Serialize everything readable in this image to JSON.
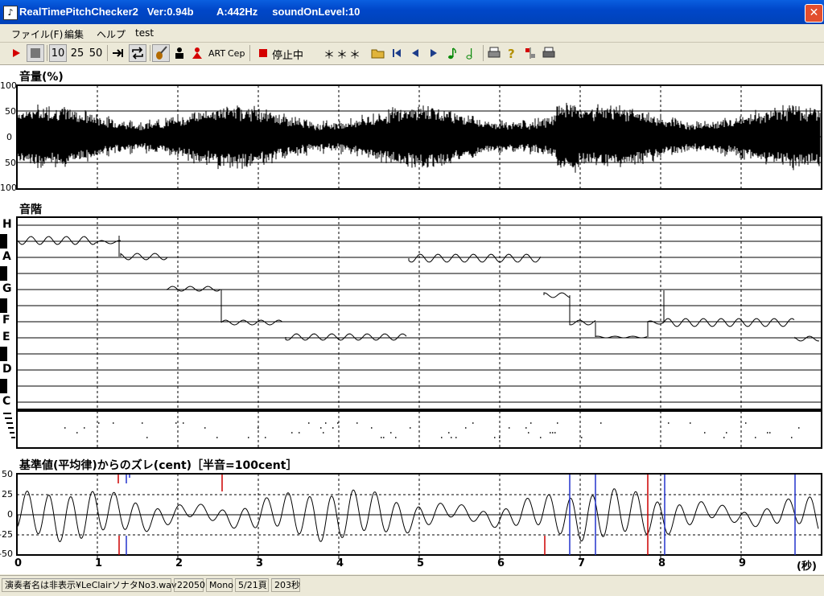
{
  "window": {
    "title": "RealTimePitchChecker2   Ver:0.94b        A:442Hz     soundOnLevel:10",
    "close_glyph": "✕"
  },
  "menu": [
    "ファイル(F)",
    "編集",
    "ヘルプ",
    "test"
  ],
  "toolbar": {
    "speed_10": "10",
    "speed_25": "25",
    "speed_50": "50",
    "art": "ART",
    "cep": "Cep",
    "status_text": "停止中",
    "stars": "＊＊＊"
  },
  "volume_panel": {
    "title": "音量(%)",
    "labels": [
      "100",
      "50",
      "0",
      "50",
      "100"
    ]
  },
  "scale_panel": {
    "title": "音階",
    "notes": [
      "H",
      "A",
      "G",
      "F",
      "E",
      "D",
      "C"
    ]
  },
  "dev_panel": {
    "title": "基準値(平均律)からのズレ(cent)［半音=100cent］",
    "labels": [
      "50",
      "25",
      "0",
      "-25",
      "-50"
    ]
  },
  "time_axis": {
    "labels": [
      "0",
      "1",
      "2",
      "3",
      "4",
      "5",
      "6",
      "7",
      "8",
      "9"
    ],
    "unit": "(秒)"
  },
  "statusbar": {
    "file": "演奏者名は非表示¥LeClairソナタNo3.wav",
    "rate": "22050",
    "channels": "Mono",
    "page": "5/21頁",
    "duration": "203秒"
  },
  "colors": {
    "title_bar": "#0047c9",
    "close_button": "#e24e2e",
    "trace": "#000000",
    "marker_red": "#cc0000",
    "marker_blue": "#2233cc"
  }
}
